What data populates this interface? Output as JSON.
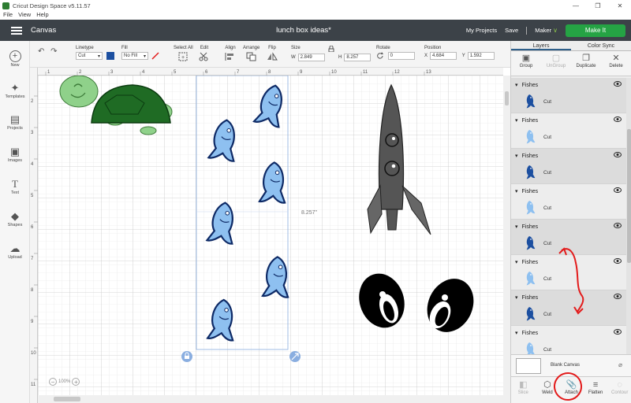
{
  "window": {
    "title": "Cricut Design Space  v5.11.57",
    "minimize": "—",
    "restore": "❐",
    "close": "✕"
  },
  "menu": [
    "File",
    "View",
    "Help"
  ],
  "header": {
    "section": "Canvas",
    "doc_title": "lunch box ideas*",
    "my_projects": "My Projects",
    "save": "Save",
    "machine": "Maker",
    "machine_chevron": "∨",
    "make_it": "Make It"
  },
  "toolbar": {
    "undo": "↶",
    "redo": "↷",
    "linetype_label": "Linetype",
    "linetype_value": "Cut",
    "fill_label": "Fill",
    "fill_value": "No Fill",
    "fill_swatch_color": "#1c4fa0",
    "select_all": "Select All",
    "edit": "Edit",
    "align": "Align",
    "arrange": "Arrange",
    "flip": "Flip",
    "size_label": "Size",
    "w_label": "W",
    "w_value": "2.849",
    "h_label": "H",
    "h_value": "8.257",
    "rotate_label": "Rotate",
    "rotate_value": "0",
    "position_label": "Position",
    "x_label": "X",
    "x_value": "4.684",
    "y_label": "Y",
    "y_value": "1.592",
    "dropdown_chevron": "▾"
  },
  "sidebar": [
    {
      "label": "New",
      "icon": "+"
    },
    {
      "label": "Templates",
      "icon": "✦"
    },
    {
      "label": "Projects",
      "icon": "▤"
    },
    {
      "label": "Images",
      "icon": "▣"
    },
    {
      "label": "Text",
      "icon": "T"
    },
    {
      "label": "Shapes",
      "icon": "◆"
    },
    {
      "label": "Upload",
      "icon": "☁"
    }
  ],
  "canvas": {
    "ruler_top": [
      "1",
      "2",
      "3",
      "4",
      "5",
      "6",
      "7",
      "8",
      "9",
      "10",
      "11",
      "12",
      "13"
    ],
    "ruler_left": [
      "2",
      "3",
      "4",
      "5",
      "6",
      "7",
      "8",
      "9",
      "10",
      "11"
    ],
    "dimension_label": "8.257\"",
    "zoom": "100%",
    "zoom_out": "−",
    "zoom_in": "+"
  },
  "panel": {
    "tabs": [
      "Layers",
      "Color Sync"
    ],
    "actions": [
      {
        "label": "Group",
        "icon": "▣",
        "enabled": true
      },
      {
        "label": "UnGroup",
        "icon": "▢",
        "enabled": false
      },
      {
        "label": "Duplicate",
        "icon": "❐",
        "enabled": true
      },
      {
        "label": "Delete",
        "icon": "✕",
        "enabled": true
      }
    ],
    "layers": [
      {
        "name": "Fishes",
        "op": "Cut",
        "color": "#1c4fa0"
      },
      {
        "name": "Fishes",
        "op": "Cut",
        "color": "#8ec0f0"
      },
      {
        "name": "Fishes",
        "op": "Cut",
        "color": "#1c4fa0"
      },
      {
        "name": "Fishes",
        "op": "Cut",
        "color": "#8ec0f0"
      },
      {
        "name": "Fishes",
        "op": "Cut",
        "color": "#1c4fa0"
      },
      {
        "name": "Fishes",
        "op": "Cut",
        "color": "#8ec0f0"
      },
      {
        "name": "Fishes",
        "op": "Cut",
        "color": "#1c4fa0"
      },
      {
        "name": "Fishes",
        "op": "Cut",
        "color": "#8ec0f0"
      }
    ],
    "layer_caret": "▾",
    "eye_glyph": "👁",
    "blank_canvas": "Blank Canvas",
    "blank_hide": "⌀",
    "bottom_actions": [
      {
        "label": "Slice",
        "icon": "◧",
        "enabled": false
      },
      {
        "label": "Weld",
        "icon": "⬡",
        "enabled": true
      },
      {
        "label": "Attach",
        "icon": "📎",
        "enabled": true
      },
      {
        "label": "Flatten",
        "icon": "≡",
        "enabled": true
      },
      {
        "label": "Contour",
        "icon": "◌",
        "enabled": false
      }
    ]
  },
  "colors": {
    "header_bg": "#3c4248",
    "make_it": "#25a344",
    "fish_light": "#8ec0f0",
    "fish_outline": "#0e2a66",
    "turtle_shell": "#1f6b24",
    "turtle_body": "#8fd18a",
    "rocket": "#555555",
    "annotation": "#e31b1b"
  }
}
